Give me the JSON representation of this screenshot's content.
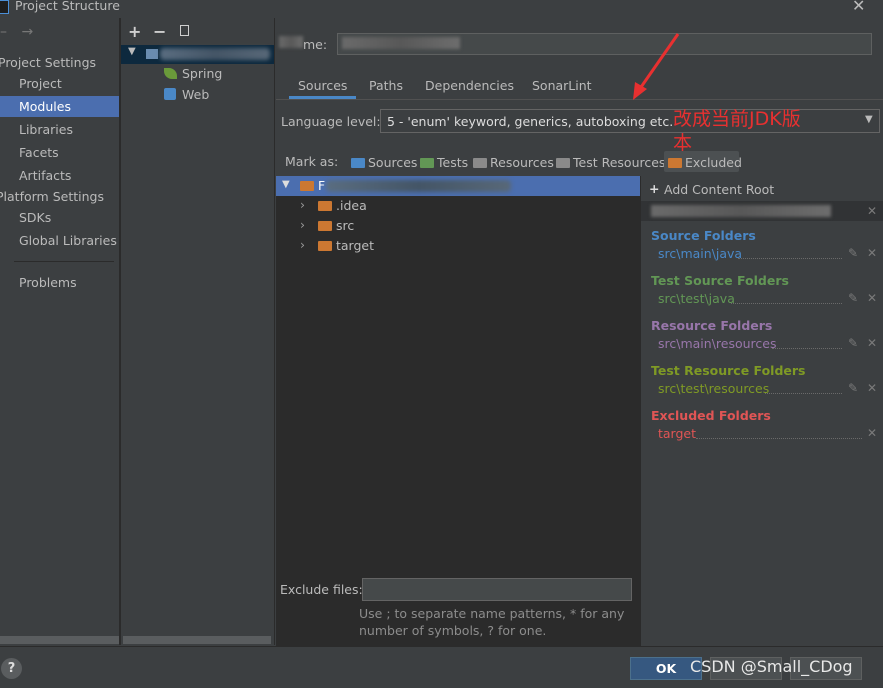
{
  "window": {
    "title": "Project Structure"
  },
  "sidebar": {
    "project_settings_header": "Project Settings",
    "project_settings_items": [
      {
        "label": "Project"
      },
      {
        "label": "Modules"
      },
      {
        "label": "Libraries"
      },
      {
        "label": "Facets"
      },
      {
        "label": "Artifacts"
      }
    ],
    "platform_settings_header": "Platform Settings",
    "platform_items": [
      {
        "label": "SDKs"
      },
      {
        "label": "Global Libraries"
      }
    ],
    "problems_label": "Problems",
    "selected": "Modules"
  },
  "module_tree": {
    "children": [
      {
        "label": "Spring",
        "icon": "spring-leaf-icon"
      },
      {
        "label": "Web",
        "icon": "web-icon"
      }
    ]
  },
  "name_field": {
    "label_fragment": "me:"
  },
  "tabs": [
    {
      "label": "Sources",
      "active": true
    },
    {
      "label": "Paths"
    },
    {
      "label": "Dependencies"
    },
    {
      "label": "SonarLint"
    }
  ],
  "language_level": {
    "label": "Language level:",
    "value": "5 - 'enum' keyword, generics, autoboxing etc."
  },
  "mark_as": {
    "label": "Mark as:",
    "buttons": [
      {
        "label": "Sources",
        "color": "#4a88c7"
      },
      {
        "label": "Tests",
        "color": "#629755"
      },
      {
        "label": "Resources",
        "color": "#9876aa"
      },
      {
        "label": "Test Resources",
        "color": "#9876aa"
      },
      {
        "label": "Excluded",
        "color": "#cc7832"
      }
    ]
  },
  "content_tree": {
    "root_prefix": "F",
    "children": [
      {
        "label": ".idea"
      },
      {
        "label": "src"
      },
      {
        "label": "target"
      }
    ]
  },
  "content_root": {
    "add_label": "Add Content Root",
    "groups": [
      {
        "header": "Source Folders",
        "path": "src\\main\\java",
        "color": "#4a88c7",
        "path_color": "#4a88c7"
      },
      {
        "header": "Test Source Folders",
        "path": "src\\test\\java",
        "color": "#629755",
        "path_color": "#629755"
      },
      {
        "header": "Resource Folders",
        "path": "src\\main\\resources",
        "color": "#9876aa",
        "path_color": "#9876aa"
      },
      {
        "header": "Test Resource Folders",
        "path": "src\\test\\resources",
        "color": "#7f9a25",
        "path_color": "#7f9a25"
      },
      {
        "header": "Excluded Folders",
        "path": "target",
        "color": "#e05555",
        "path_color": "#e05555"
      }
    ]
  },
  "exclude_files": {
    "label": "Exclude files:",
    "hint_line1": "Use ; to separate name patterns, * for any",
    "hint_line2": "number of symbols, ? for one."
  },
  "footer": {
    "ok_label": "OK",
    "help_label": "?"
  },
  "annotation": {
    "text_line1": "改成当前JDK版",
    "text_line2": "本",
    "color": "#e83030"
  },
  "watermark": "CSDN @Small_CDog",
  "colors": {
    "accent": "#4b6eaf",
    "ok_button": "#365880",
    "tree_bg": "#2b2b2b"
  }
}
